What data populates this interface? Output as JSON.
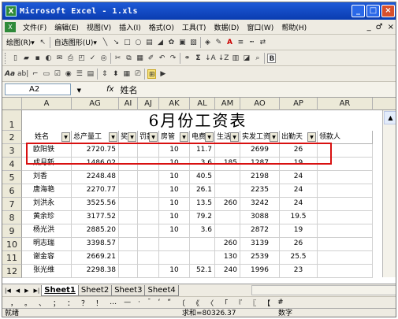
{
  "titlebar": {
    "title": "Microsoft Excel - 1.xls",
    "app_icon": "X",
    "min": "_",
    "max": "□",
    "close": "×"
  },
  "menu": {
    "icon": "X",
    "items": [
      "文件(F)",
      "编辑(E)",
      "视图(V)",
      "插入(I)",
      "格式(O)",
      "工具(T)",
      "数据(D)",
      "窗口(W)",
      "帮助(H)"
    ],
    "right": [
      "_",
      "♂",
      "×"
    ]
  },
  "toolbar1": {
    "draw_label": "绘图(R)▾",
    "autoshape_label": "自选图形(U)▾"
  },
  "toolbar3": {
    "aa_label": "Aa",
    "abl_label": "ab|"
  },
  "formula_bar": {
    "name_box": "A2",
    "fx": "fx",
    "value": "姓名"
  },
  "columns": [
    "A",
    "AG",
    "AI",
    "AJ",
    "AK",
    "AL",
    "AM",
    "AO",
    "AP",
    "AR"
  ],
  "row_numbers": [
    "1",
    "2",
    "3",
    "4",
    "5",
    "6",
    "7",
    "8",
    "9",
    "10",
    "11",
    "12"
  ],
  "sheet_title": "6月份工资表",
  "headers": [
    "姓名",
    "总产量工",
    "奖励",
    "罚款",
    "房管",
    "电费",
    "生活",
    "实发工资",
    "出勤天",
    "领款人"
  ],
  "rows": [
    [
      "欧阳铁",
      "2720.75",
      "",
      "",
      "10",
      "11.7",
      "",
      "2699",
      "26"
    ],
    [
      "成月新",
      "1486.02",
      "",
      "",
      "10",
      "3.6",
      "185",
      "1287",
      "19"
    ],
    [
      "刘香",
      "2248.48",
      "",
      "",
      "10",
      "40.5",
      "",
      "2198",
      "24"
    ],
    [
      "唐海艳",
      "2270.77",
      "",
      "",
      "10",
      "26.1",
      "",
      "2235",
      "24"
    ],
    [
      "刘洪永",
      "3525.56",
      "",
      "",
      "10",
      "13.5",
      "260",
      "3242",
      "24"
    ],
    [
      "黄余珍",
      "3177.52",
      "",
      "",
      "10",
      "79.2",
      "",
      "3088",
      "19.5"
    ],
    [
      "杨光洪",
      "2885.20",
      "",
      "",
      "10",
      "3.6",
      "",
      "2872",
      "19"
    ],
    [
      "明志瑞",
      "3398.57",
      "",
      "",
      "",
      "",
      "260",
      "3139",
      "26"
    ],
    [
      "谢金容",
      "2669.21",
      "",
      "",
      "",
      "",
      "130",
      "2539",
      "25.5"
    ],
    [
      "张光维",
      "2298.38",
      "",
      "",
      "10",
      "52.1",
      "240",
      "1996",
      "23"
    ]
  ],
  "sheets": [
    "Sheet1",
    "Sheet2",
    "Sheet3",
    "Sheet4"
  ],
  "symbols": [
    "，",
    "。",
    "、",
    "；",
    "：",
    "？",
    "！",
    "…",
    "—",
    "·",
    "ˉ",
    "‘",
    "“",
    "〔",
    "《",
    "〈",
    "「",
    "『",
    "〖",
    "【",
    "#"
  ],
  "status": {
    "left": "就绪",
    "sum": "求和=80326.37",
    "mode": "数字"
  }
}
